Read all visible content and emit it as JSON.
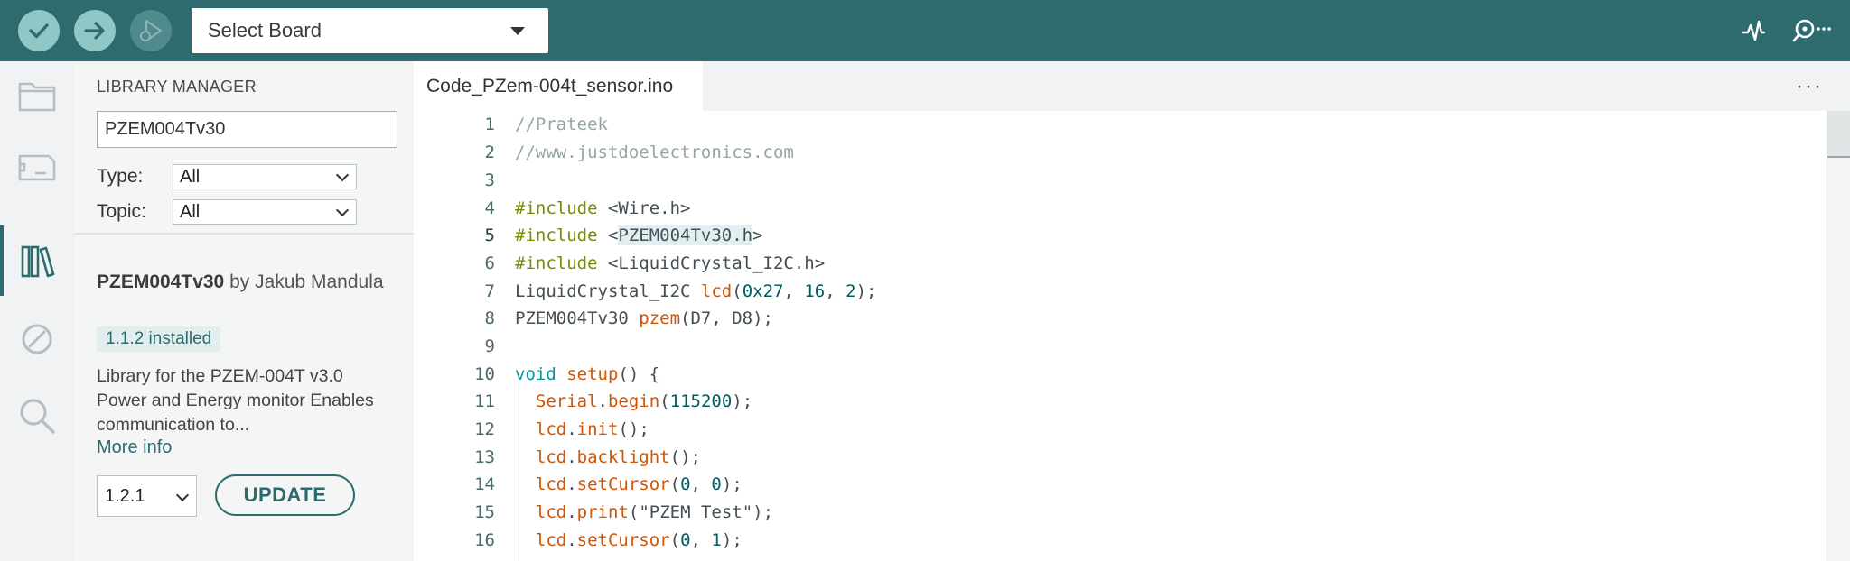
{
  "toolbar": {
    "verify_icon": "checkmark-icon",
    "upload_icon": "arrow-right-icon",
    "debug_icon": "debug-play-icon",
    "board_select": "Select Board",
    "serial_plotter_icon": "serial-plotter-icon",
    "serial_monitor_icon": "serial-monitor-icon",
    "colors": {
      "toolbar_bg": "#2d6b6f",
      "button_bg": "#8fc7c6"
    }
  },
  "activity_bar": {
    "items": [
      {
        "name": "sketchbook",
        "icon": "folder-icon"
      },
      {
        "name": "boards-manager",
        "icon": "board-icon"
      },
      {
        "name": "library-manager",
        "icon": "library-icon",
        "active": true
      },
      {
        "name": "debug",
        "icon": "no-entry-icon"
      },
      {
        "name": "search",
        "icon": "search-icon"
      }
    ]
  },
  "library_manager": {
    "title": "LIBRARY MANAGER",
    "search_value": "PZEM004Tv30",
    "type_label": "Type:",
    "type_value": "All",
    "topic_label": "Topic:",
    "topic_value": "All",
    "library": {
      "name": "PZEM004Tv30",
      "by": "by",
      "author": "Jakub Mandula",
      "installed_badge": "1.1.2 installed",
      "description": "Library for the PZEM-004T v3.0 Power and Energy monitor Enables communication to...",
      "more_info": "More info",
      "version_select": "1.2.1",
      "update_label": "UPDATE"
    }
  },
  "editor": {
    "tab_label": "Code_PZem-004t_sensor.ino",
    "more_icon": "more-horizontal-icon",
    "line_numbers": [
      "1",
      "2",
      "3",
      "4",
      "5",
      "6",
      "7",
      "8",
      "9",
      "10",
      "11",
      "12",
      "13",
      "14",
      "15",
      "16"
    ],
    "lines": [
      "//Prateek",
      "//www.justdoelectronics.com",
      "",
      "#include <Wire.h>",
      "#include <PZEM004Tv30.h>",
      "#include <LiquidCrystal_I2C.h>",
      "LiquidCrystal_I2C lcd(0x27, 16, 2);",
      "PZEM004Tv30 pzem(D7, D8);",
      "",
      "void setup() {",
      "  Serial.begin(115200);",
      "  lcd.init();",
      "  lcd.backlight();",
      "  lcd.setCursor(0, 0);",
      "  lcd.print(\"PZEM Test\");",
      "  lcd.setCursor(0, 1);"
    ]
  }
}
